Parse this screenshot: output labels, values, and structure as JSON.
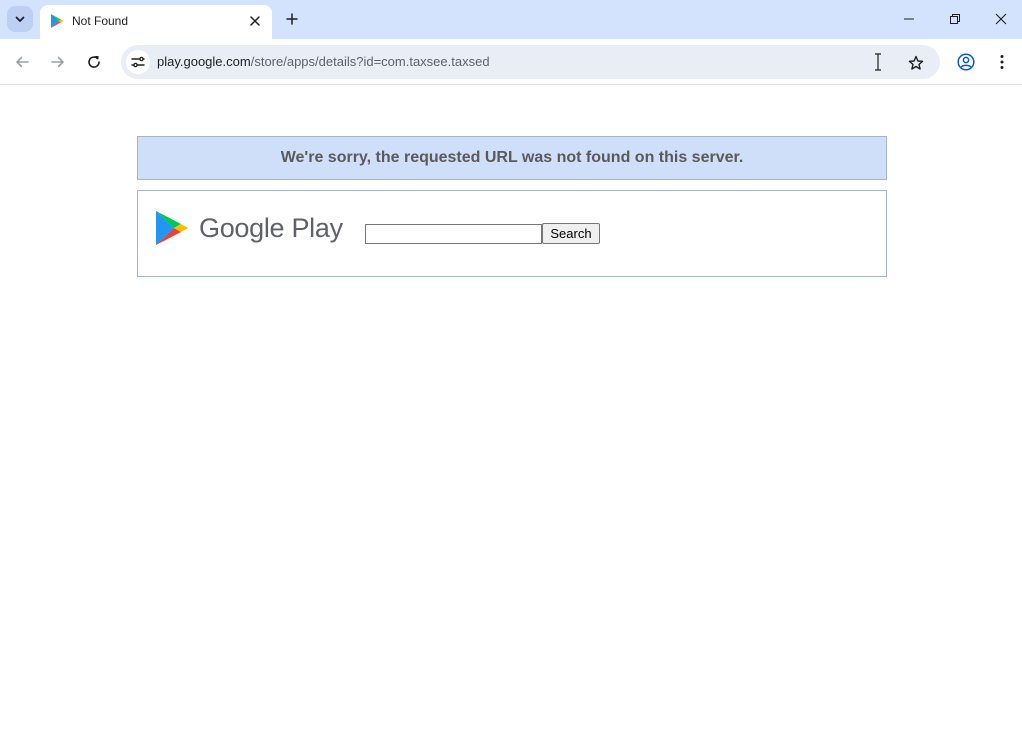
{
  "browser": {
    "tab": {
      "title": "Not Found",
      "favicon": "google-play-icon"
    },
    "address_bar": {
      "host": "play.google.com",
      "path": "/store/apps/details?id=com.taxsee.taxsed"
    },
    "icons": {
      "tab_search": "chevron-down-icon",
      "tab_close": "close-icon",
      "new_tab": "plus-icon",
      "minimize": "minimize-icon",
      "restore": "restore-icon",
      "window_close": "close-icon",
      "back": "back-arrow-icon",
      "forward": "forward-arrow-icon",
      "reload": "reload-icon",
      "site_info": "tune-icon",
      "bookmark": "star-icon",
      "profile": "account-icon",
      "menu": "more-vertical-icon"
    }
  },
  "page": {
    "error_message": "We're sorry, the requested URL was not found on this server.",
    "logo_text": "Google Play",
    "search": {
      "value": "",
      "button_label": "Search"
    }
  },
  "colors": {
    "tabstrip_bg": "#d3e3fd",
    "banner_bg": "#d0dff9",
    "banner_border": "#a5b3cc",
    "omnibox_bg": "#e9eef6"
  }
}
